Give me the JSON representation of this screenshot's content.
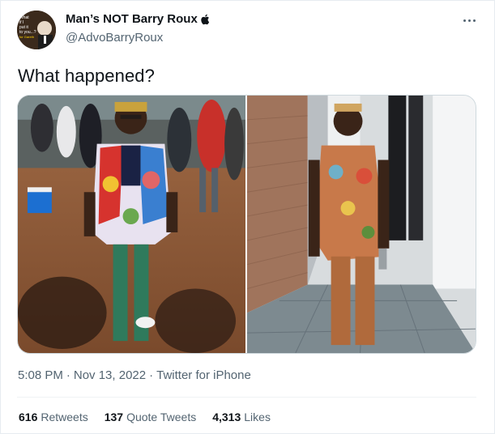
{
  "author": {
    "display_name": "Man’s NOT Barry Roux",
    "handle": "@AdvoBarryRoux",
    "avatar_text": [
      "What",
      "if I",
      "put it",
      "to you...?",
      "for Gareth"
    ]
  },
  "tweet": {
    "text": "What happened?"
  },
  "meta": {
    "time": "5:08 PM",
    "separator1": "·",
    "date": "Nov 13, 2022",
    "separator2": "·",
    "source": "Twitter for iPhone"
  },
  "stats": {
    "retweets_count": "616",
    "retweets_label": "Retweets",
    "quotes_count": "137",
    "quotes_label": "Quote Tweets",
    "likes_count": "4,313",
    "likes_label": "Likes"
  },
  "colors": {
    "text_primary": "#0f1419",
    "text_secondary": "#536471",
    "border": "#cfd9de"
  },
  "icons": {
    "verified_symbol": "apple-icon",
    "more": "more-icon"
  }
}
